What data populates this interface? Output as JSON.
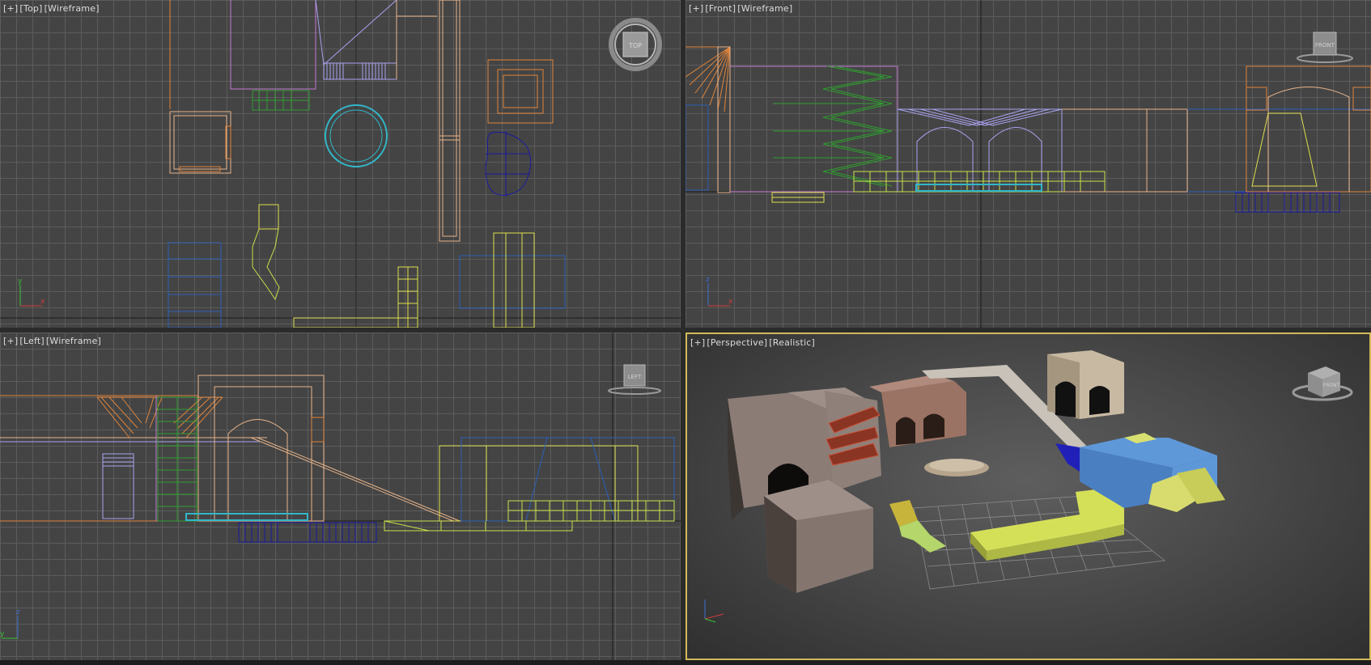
{
  "viewports": {
    "top": {
      "plus": "[+]",
      "view": "[Top]",
      "mode": "[Wireframe]",
      "cube_label": "TOP"
    },
    "front": {
      "plus": "[+]",
      "view": "[Front]",
      "mode": "[Wireframe]",
      "cube_label": "FRONT"
    },
    "left": {
      "plus": "[+]",
      "view": "[Left]",
      "mode": "[Wireframe]",
      "cube_label": "LEFT"
    },
    "perspective": {
      "plus": "[+]",
      "view": "[Perspective]",
      "mode": "[Realistic]",
      "cube_label": "FRONT"
    }
  },
  "axes": {
    "x": "x",
    "y": "y",
    "z": "z"
  },
  "colors": {
    "grid": "#5c5c5c",
    "background": "#444444",
    "active_border": "#d2b85a",
    "orange": "#e0843a",
    "peach": "#e8b48a",
    "violet": "#c67ad6",
    "lavender": "#a9a3f0",
    "green": "#2f9e2f",
    "lime": "#c9e24a",
    "cyan": "#31b7c9",
    "blue": "#2a5fb8",
    "navy": "#1a1aa0",
    "yellow": "#dede4e"
  }
}
